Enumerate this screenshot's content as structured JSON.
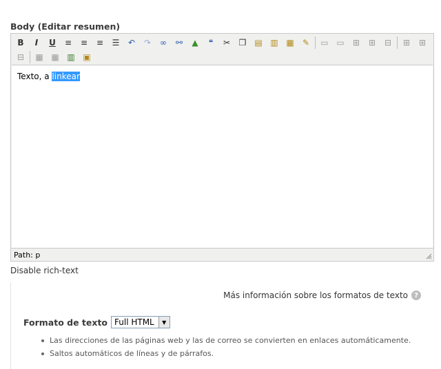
{
  "field": {
    "label": "Body",
    "edit_summary": "(Editar resumen)"
  },
  "toolbar": {
    "row1": [
      {
        "name": "bold-button",
        "icon": "bold-icon",
        "glyph": "B"
      },
      {
        "name": "italic-button",
        "icon": "italic-icon",
        "glyph": "I"
      },
      {
        "name": "underline-button",
        "icon": "underline-icon",
        "glyph": "U"
      },
      {
        "name": "align-left-button",
        "icon": "align-left-icon",
        "glyph": "≡"
      },
      {
        "name": "align-center-button",
        "icon": "align-center-icon",
        "glyph": "≡"
      },
      {
        "name": "align-right-button",
        "icon": "align-right-icon",
        "glyph": "≡"
      },
      {
        "name": "align-justify-button",
        "icon": "align-justify-icon",
        "glyph": "☰"
      },
      {
        "name": "undo-button",
        "icon": "undo-icon",
        "glyph": "↶"
      },
      {
        "name": "redo-button",
        "icon": "redo-icon",
        "glyph": "↷"
      },
      {
        "name": "link-button",
        "icon": "link-icon",
        "glyph": "∞"
      },
      {
        "name": "unlink-button",
        "icon": "unlink-icon",
        "glyph": "⚯"
      },
      {
        "name": "insert-image-button",
        "icon": "image-icon",
        "glyph": "▲"
      },
      {
        "name": "blockquote-button",
        "icon": "quote-icon",
        "glyph": "❝"
      },
      {
        "name": "cut-button",
        "icon": "scissors-icon",
        "glyph": "✂"
      },
      {
        "name": "copy-button",
        "icon": "copy-icon",
        "glyph": "❐"
      },
      {
        "name": "paste-button",
        "icon": "paste-icon",
        "glyph": "▤"
      },
      {
        "name": "paste-text-button",
        "icon": "paste-text-icon",
        "glyph": "▥"
      },
      {
        "name": "paste-word-button",
        "icon": "paste-word-icon",
        "glyph": "▦"
      },
      {
        "name": "cleanup-button",
        "icon": "edit-source-icon",
        "glyph": "✎"
      },
      {
        "name": "table-row-props-button",
        "icon": "table-row-icon",
        "glyph": "▭"
      },
      {
        "name": "table-cell-props-button",
        "icon": "table-cell-icon",
        "glyph": "▭"
      },
      {
        "name": "insert-row-before-button",
        "icon": "row-before-icon",
        "glyph": "⊞"
      },
      {
        "name": "insert-row-after-button",
        "icon": "row-after-icon",
        "glyph": "⊞"
      },
      {
        "name": "delete-row-button",
        "icon": "delete-row-icon",
        "glyph": "⊟"
      },
      {
        "name": "insert-col-before-button",
        "icon": "col-before-icon",
        "glyph": "⊞"
      },
      {
        "name": "insert-col-after-button",
        "icon": "col-after-icon",
        "glyph": "⊞"
      }
    ],
    "row2": [
      {
        "name": "delete-col-button",
        "icon": "delete-col-icon",
        "glyph": "⊟"
      },
      {
        "name": "split-cells-button",
        "icon": "split-cells-icon",
        "glyph": "▦"
      },
      {
        "name": "merge-cells-button",
        "icon": "merge-cells-icon",
        "glyph": "▦"
      },
      {
        "name": "insert-media-button",
        "icon": "film-icon",
        "glyph": "▥"
      },
      {
        "name": "image-properties-button",
        "icon": "image-properties-icon",
        "glyph": "▣"
      }
    ]
  },
  "editor": {
    "text_before": "Texto, a ",
    "selected_text": "linkear",
    "path_label": "Path: p"
  },
  "disable_rich_text": "Disable rich-text",
  "formats": {
    "more_info": "Más información sobre los formatos de texto",
    "help_glyph": "?",
    "label": "Formato de texto",
    "selected": "Full HTML",
    "tips": [
      "Las direcciones de las páginas web y las de correo se convierten en enlaces automáticamente.",
      "Saltos automáticos de líneas y de párrafos."
    ]
  },
  "colors": {
    "selection": "#3399ff",
    "toolbar_bg": "#f0f0ee",
    "border": "#c9c9c9"
  }
}
